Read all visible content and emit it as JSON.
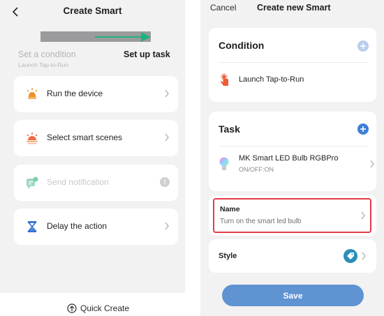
{
  "left": {
    "title": "Create Smart",
    "progress": 1.0,
    "steps": {
      "condition": "Set a condition",
      "condition_sub": "Launch Tap-to-Run",
      "task": "Set up task"
    },
    "options": [
      {
        "label": "Run the device",
        "icon": "light-bulb-icon",
        "enabled": true
      },
      {
        "label": "Select smart scenes",
        "icon": "sunrise-icon",
        "enabled": true
      },
      {
        "label": "Send notification",
        "icon": "notification-phone-icon",
        "enabled": false
      },
      {
        "label": "Delay the action",
        "icon": "hourglass-icon",
        "enabled": true
      }
    ],
    "quick_create": "Quick Create"
  },
  "right": {
    "cancel": "Cancel",
    "title": "Create new Smart",
    "condition": {
      "title": "Condition",
      "item": "Launch Tap-to-Run",
      "item_icon": "tap-hand-icon"
    },
    "task": {
      "title": "Task",
      "device_name": "MK Smart LED Bulb RGBPro",
      "device_state": "ON/OFF:ON",
      "device_icon": "rgb-bulb-icon"
    },
    "name": {
      "label": "Name",
      "value": "Turn on the smart led bulb"
    },
    "style": {
      "label": "Style",
      "icon": "tag-style-icon"
    },
    "save": "Save"
  },
  "colors": {
    "accent_blue": "#3d7fd9",
    "save_blue": "#5f93d2",
    "highlight_red": "#e53a47",
    "progress_arrow": "#1fb37a",
    "orange_icon": "#f0902c",
    "style_teal": "#2a8fb8"
  }
}
